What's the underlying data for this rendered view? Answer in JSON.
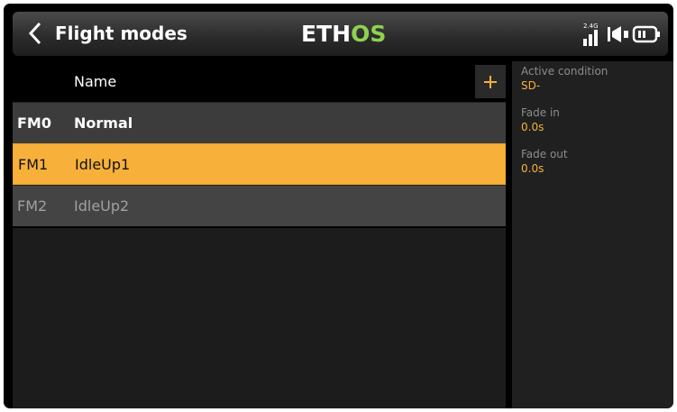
{
  "header": {
    "title": "Flight modes",
    "logo_main": "ETH",
    "logo_accent": "OS",
    "radio_band": "2.4G"
  },
  "list": {
    "column_name": "Name",
    "add_label": "+",
    "rows": [
      {
        "id": "FM0",
        "name": "Normal"
      },
      {
        "id": "FM1",
        "name": "IdleUp1"
      },
      {
        "id": "FM2",
        "name": "IdleUp2"
      }
    ]
  },
  "side_panel": {
    "active_condition": {
      "label": "Active condition",
      "value": "SD-"
    },
    "fade_in": {
      "label": "Fade in",
      "value": "0.0s"
    },
    "fade_out": {
      "label": "Fade out",
      "value": "0.0s"
    }
  },
  "colors": {
    "selected_row": "#f7b13a",
    "accent_value": "#f7b13a",
    "logo_accent": "#8fd14f"
  },
  "icons": [
    "chevron-left-icon",
    "plus-icon",
    "signal-icon",
    "speaker-icon",
    "battery-icon"
  ]
}
